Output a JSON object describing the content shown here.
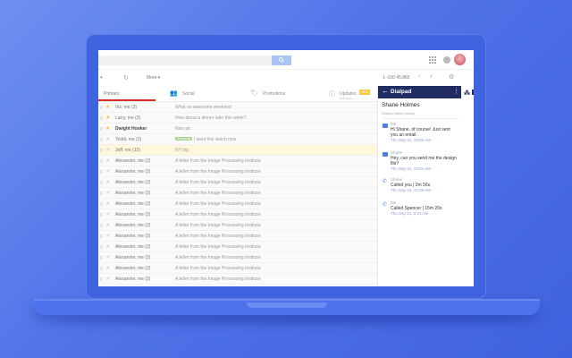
{
  "toolbar": {
    "more_label": "More ▾",
    "pager_text": "1–100   45,865"
  },
  "tabs": {
    "primary": "Primary",
    "social": "Social",
    "promotions": "Promotions",
    "updates": "Updates",
    "updates_badge": "NEW",
    "updates_sub": "Notification"
  },
  "emails": [
    {
      "sender": "Viz, me (3)",
      "subject": "What an awesome weekend",
      "starred": true,
      "bold": false,
      "chip": ""
    },
    {
      "sender": "Larry, me (3)",
      "subject": "How about a dinner later this week?",
      "starred": true,
      "bold": false,
      "chip": ""
    },
    {
      "sender": "Dwight Hooker",
      "subject": "Nice pic",
      "starred": true,
      "bold": true,
      "chip": ""
    },
    {
      "sender": "Teddi, me (3)",
      "subject": "I want this watch now",
      "starred": false,
      "bold": false,
      "chip": "Shopping"
    },
    {
      "sender": "Jeff, me (12)",
      "subject": "NY trip",
      "starred": false,
      "bold": false,
      "chip": "",
      "highlight": true
    },
    {
      "sender": "Alexander, me (2)",
      "subject": "A letter from the Image Processing Institute",
      "starred": false,
      "bold": false,
      "chip": ""
    },
    {
      "sender": "Alexander, me (2)",
      "subject": "A letter from the Image Processing Institute",
      "starred": false,
      "bold": false,
      "chip": ""
    },
    {
      "sender": "Alexander, me (2)",
      "subject": "A letter from the Image Processing Institute",
      "starred": false,
      "bold": false,
      "chip": ""
    },
    {
      "sender": "Alexander, me (2)",
      "subject": "A letter from the Image Processing Institute",
      "starred": false,
      "bold": false,
      "chip": ""
    },
    {
      "sender": "Alexander, me (2)",
      "subject": "A letter from the Image Processing Institute",
      "starred": false,
      "bold": false,
      "chip": ""
    },
    {
      "sender": "Alexander, me (2)",
      "subject": "A letter from the Image Processing Institute",
      "starred": false,
      "bold": false,
      "chip": ""
    },
    {
      "sender": "Alexander, me (2)",
      "subject": "A letter from the Image Processing Institute",
      "starred": false,
      "bold": false,
      "chip": ""
    },
    {
      "sender": "Alexander, me (2)",
      "subject": "A letter from the Image Processing Institute",
      "starred": false,
      "bold": false,
      "chip": ""
    },
    {
      "sender": "Alexander, me (2)",
      "subject": "A letter from the Image Processing Institute",
      "starred": false,
      "bold": false,
      "chip": ""
    },
    {
      "sender": "Alexander, me (2)",
      "subject": "A letter from the Image Processing Institute",
      "starred": false,
      "bold": false,
      "chip": ""
    },
    {
      "sender": "Alexander, me (2)",
      "subject": "A letter from the Image Processing Institute",
      "starred": false,
      "bold": false,
      "chip": ""
    },
    {
      "sender": "Alexander, me (2)",
      "subject": "A letter from the Image Processing Institute",
      "starred": false,
      "bold": false,
      "chip": ""
    }
  ],
  "dialpad": {
    "title": "Dialpad",
    "contact_name": "Shane Holmes",
    "subtitle": "Dialpad latest history",
    "activities": [
      {
        "type": "chat",
        "who": "Me",
        "text": "Hi Shane, of course! Just sent you an email.",
        "time": "Thu Sep 21, 10:06 AM"
      },
      {
        "type": "chat",
        "who": "Shane",
        "text": "Hey, can you send me the design file?",
        "time": "Thu Sep 21, 10:04 AM"
      },
      {
        "type": "call",
        "who": "Shane",
        "text": "Called you  |  2m 56s",
        "time": "Thu Sep 21, 10:28 AM"
      },
      {
        "type": "call",
        "who": "Me",
        "text": "Called Spencer  |  15m 20s",
        "time": "Thu Sep 21, 9:24 AM"
      }
    ]
  },
  "colors": {
    "background": "#4f72e8",
    "dialpad_header": "#1f2d63",
    "accent_blue": "#4a7fe0",
    "star_gold": "#f4c430",
    "primary_tab_underline": "#d93025",
    "highlight_row": "#fff7da"
  },
  "icons": {
    "search": "search-icon",
    "apps": "apps-grid-icon",
    "notifications": "notifications-icon",
    "refresh": "refresh-icon",
    "settings": "gear-icon",
    "back": "arrow-left-icon",
    "menu": "more-vert-icon"
  }
}
